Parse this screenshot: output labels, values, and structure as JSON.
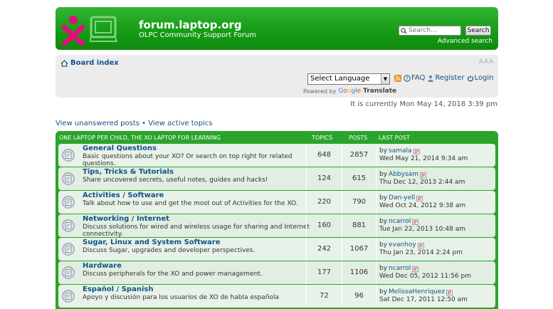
{
  "header": {
    "site_title": "forum.laptop.org",
    "site_desc": "OLPC Community Support Forum",
    "search_placeholder": "Search…",
    "search_button": "Search",
    "advanced_search": "Advanced search",
    "brand_colors": {
      "green": "#159a15",
      "x_magenta": "#e0107a"
    }
  },
  "nav": {
    "board_index": "Board index",
    "font_resize": "A A A",
    "language_select": "Select Language",
    "powered_by": "Powered by",
    "google": "Google",
    "translate": "Translate",
    "faq": "FAQ",
    "register": "Register",
    "login": "Login"
  },
  "current_time": "It is currently Mon May 14, 2018 3:39 pm",
  "quick_links": {
    "unanswered": "View unanswered posts",
    "separator": " • ",
    "active": "View active topics"
  },
  "forum_table": {
    "heading": "ONE LAPTOP PER CHILD, THE XO LAPTOP FOR LEARNING",
    "col_topics": "TOPICS",
    "col_posts": "POSTS",
    "col_last": "LAST POST",
    "by_prefix": "by",
    "rows": [
      {
        "title": "General Questions",
        "desc": "Basic questions about your XO? Or search on top right for related questions.",
        "topics": "648",
        "posts": "2857",
        "last_by": "samala",
        "last_date": "Wed May 21, 2014 9:34 am"
      },
      {
        "title": "Tips, Tricks & Tutorials",
        "desc": "Share uncovered secrets, useful notes, guides and hacks!",
        "topics": "124",
        "posts": "615",
        "last_by": "Abbysam",
        "last_date": "Thu Dec 12, 2013 2:44 am"
      },
      {
        "title": "Activities / Software",
        "desc": "Talk about how to use and get the most out of Activities for the XO.",
        "topics": "220",
        "posts": "790",
        "last_by": "Dan-yell",
        "last_date": "Wed Oct 24, 2012 9:38 am"
      },
      {
        "title": "Networking / Internet",
        "desc": "Discuss solutions for wired and wireless usage for sharing and Internet connectivity.",
        "topics": "160",
        "posts": "881",
        "last_by": "ncarrol",
        "last_date": "Tue Jan 22, 2013 10:48 am"
      },
      {
        "title": "Sugar, Linux and System Software",
        "desc": "Discuss Sugar, upgrades and developer perspectives.",
        "topics": "242",
        "posts": "1067",
        "last_by": "evanhoy",
        "last_date": "Thu Jan 23, 2014 2:24 pm"
      },
      {
        "title": "Hardware",
        "desc": "Discuss peripherals for the XO and power management.",
        "topics": "177",
        "posts": "1106",
        "last_by": "ncarrol",
        "last_date": "Wed Dec 05, 2012 11:56 pm"
      },
      {
        "title": "Español / Spanish",
        "desc": "Apoyo y discusión para los usuarios de XO de habla española",
        "topics": "72",
        "posts": "96",
        "last_by": "MelissaHenriquez",
        "last_date": "Sat Dec 17, 2011 12:50 am"
      }
    ]
  }
}
